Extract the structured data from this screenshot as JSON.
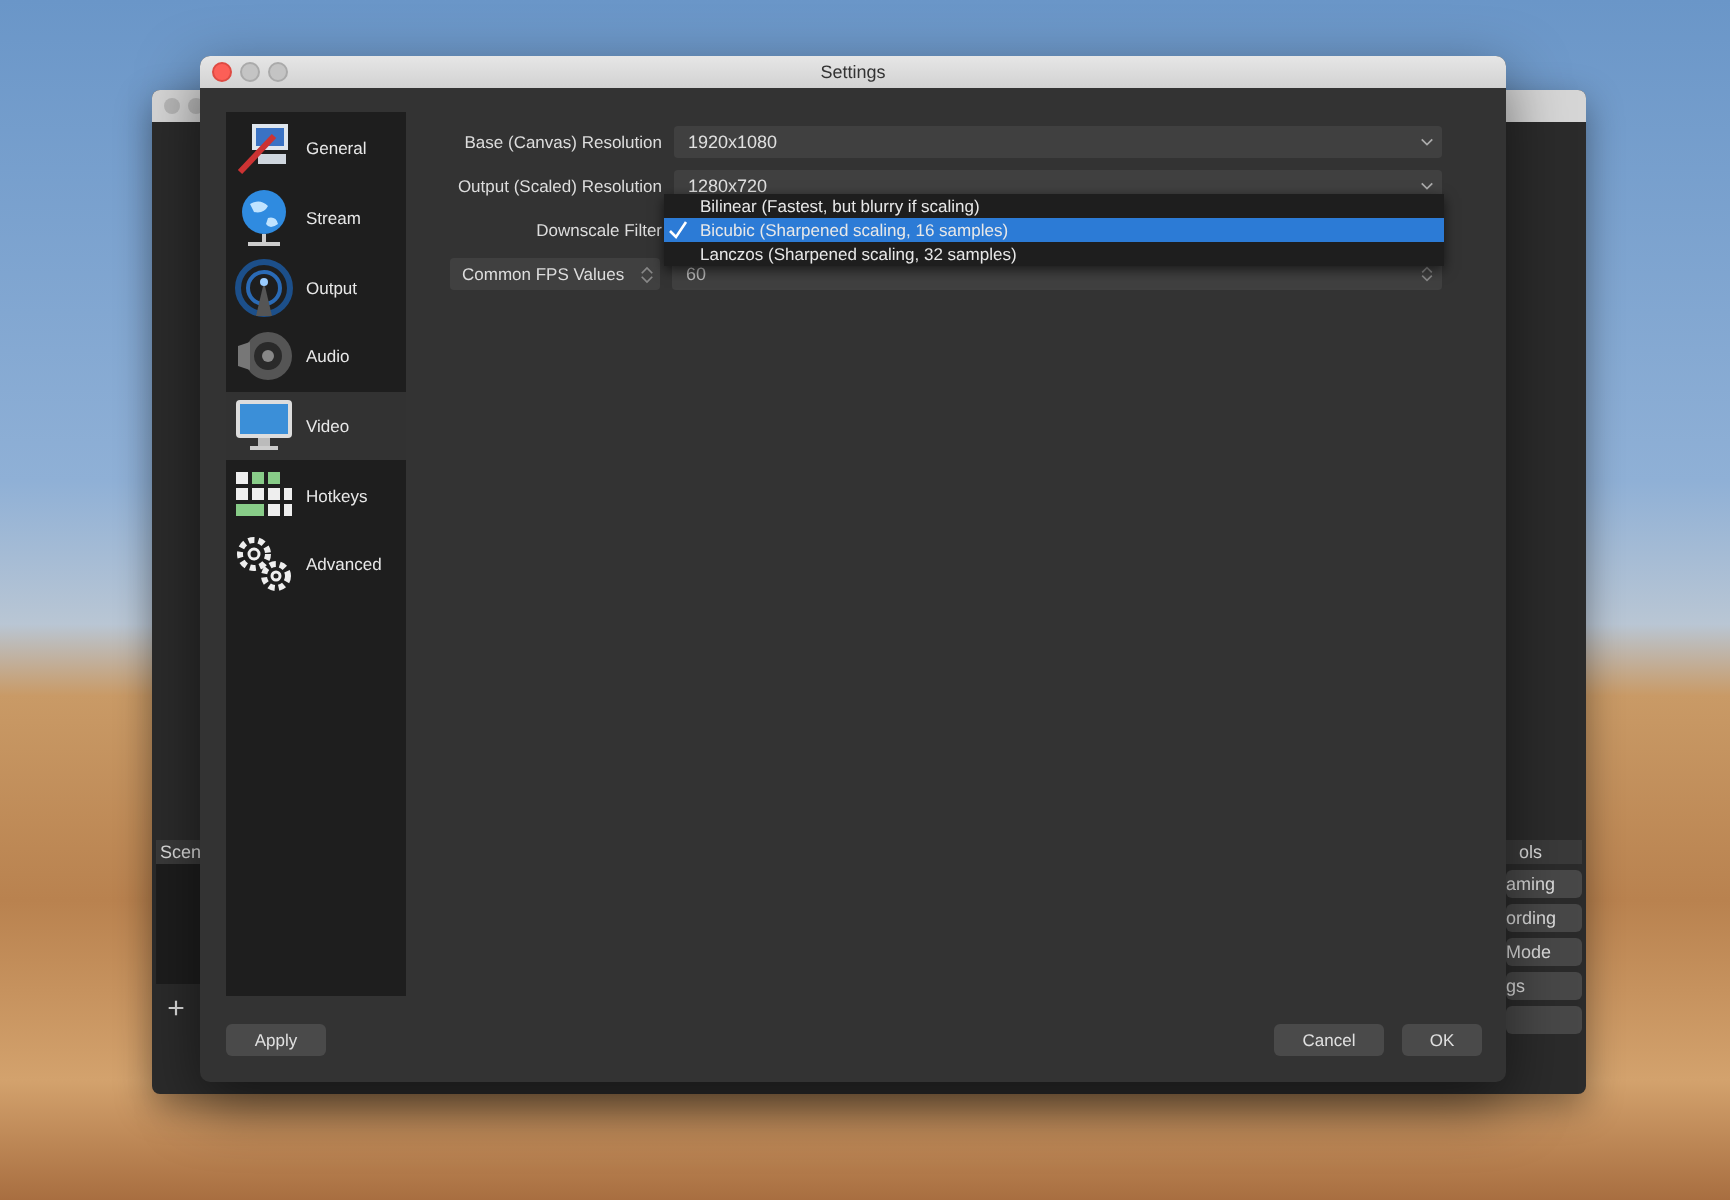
{
  "background_window": {
    "scenes_panel": {
      "header": "Scen",
      "add_button": "+"
    },
    "controls_panel": {
      "header": "ols",
      "buttons": [
        "aming",
        "ording",
        "Mode",
        "gs"
      ]
    }
  },
  "window": {
    "title": "Settings"
  },
  "sidebar": {
    "items": [
      {
        "label": "General",
        "selected": false
      },
      {
        "label": "Stream",
        "selected": false
      },
      {
        "label": "Output",
        "selected": false
      },
      {
        "label": "Audio",
        "selected": false
      },
      {
        "label": "Video",
        "selected": true
      },
      {
        "label": "Hotkeys",
        "selected": false
      },
      {
        "label": "Advanced",
        "selected": false
      }
    ]
  },
  "form": {
    "rows": [
      {
        "kind": "select",
        "label": "Base (Canvas) Resolution",
        "value": "1920x1080"
      },
      {
        "kind": "select",
        "label": "Output (Scaled) Resolution",
        "value": "1280x720"
      },
      {
        "kind": "open-select",
        "label": "Downscale Filter",
        "options": [
          {
            "label": "Bilinear (Fastest, but blurry if scaling)",
            "selected": false
          },
          {
            "label": "Bicubic (Sharpened scaling, 16 samples)",
            "selected": true
          },
          {
            "label": "Lanczos (Sharpened scaling, 32 samples)",
            "selected": false
          }
        ]
      },
      {
        "kind": "spin-select",
        "label": "Common FPS Values",
        "value": "60"
      }
    ]
  },
  "buttons": {
    "apply": "Apply",
    "cancel": "Cancel",
    "ok": "OK"
  }
}
